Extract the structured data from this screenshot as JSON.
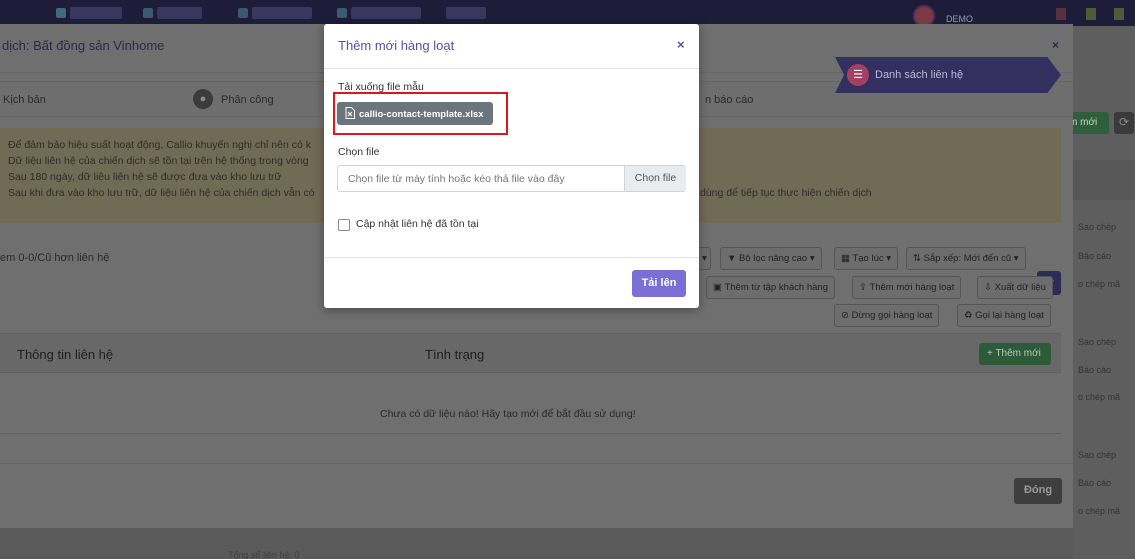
{
  "topbar": {
    "user_label": "DEMO",
    "colors": {
      "bg": "#1f1c3a"
    }
  },
  "background_modal": {
    "title": "dịch: Bất đồng sản Vinhome",
    "steps": [
      {
        "label": "Kịch bản",
        "icon": "script-icon"
      },
      {
        "label": "Phân công",
        "icon": "users-icon"
      },
      {
        "label": "n báo cáo",
        "icon": "report-icon"
      },
      {
        "label": "Danh sách liên hệ",
        "icon": "contacts-icon",
        "active": true
      }
    ],
    "warning_lines": [
      "Để đảm bảo hiệu suất hoạt động, Callio khuyến nghị chỉ nên có k",
      "Dữ liệu liên hệ của chiến dịch sẽ tồn tại trên hệ thống trong vòng",
      "Sau 180 ngày, dữ liệu liên hệ sẽ được đưa vào kho lưu trữ",
      "Sau khi đưa vào kho lưu trữ, dữ liệu liên hệ của chiến dịch vẫn có",
      "dùng để tiếp tục thực hiện chiến dịch"
    ],
    "contact_count": "em 0-0/Cũ hơn liên hệ",
    "toolbar": {
      "advanced_filter": "Bộ lọc nâng cao",
      "created": "Tạo lúc",
      "sort": "Sắp xếp: Mới đến cũ",
      "add_from_set": "Thêm từ tập khách hàng",
      "bulk_add": "Thêm mới hàng loạt",
      "export": "Xuất dữ liệu",
      "stop_calls": "Dừng gọi hàng loạt",
      "recall": "Gọi lại hàng loạt"
    },
    "table": {
      "headers": [
        "Thông tin liên hệ",
        "Tình trạng"
      ],
      "add_new": "Thêm mới",
      "empty_text": "Chưa có dữ liệu nào! Hãy tạo mới để bắt đầu sử dụng!"
    },
    "close_label": "Đóng"
  },
  "right_strip": {
    "add_button": "m mới",
    "items": [
      "Sao chép",
      "Báo cáo",
      "o chép mã",
      "Sao chép",
      "Báo cáo",
      "o chép mã",
      "Sao chép",
      "Báo cáo",
      "o chép mã"
    ],
    "total_label": "Tổng số liên hệ: 0"
  },
  "modal": {
    "title": "Thêm mới hàng loạt",
    "close": "×",
    "download_label": "Tải xuống file mẫu",
    "template_file": "callio-contact-template.xlsx",
    "file_label": "Chọn file",
    "file_placeholder": "Chọn file từ máy tính hoặc kéo thả file vào đây",
    "file_button": "Chọn file",
    "update_existing_label": "Cập nhật liên hệ đã tồn tại",
    "update_existing_checked": false,
    "upload_button": "Tải lên",
    "colors": {
      "title": "#5a4fa8",
      "upload": "#7b6fd6",
      "highlight": "#e0141c",
      "download_btn": "#6c757d"
    }
  }
}
